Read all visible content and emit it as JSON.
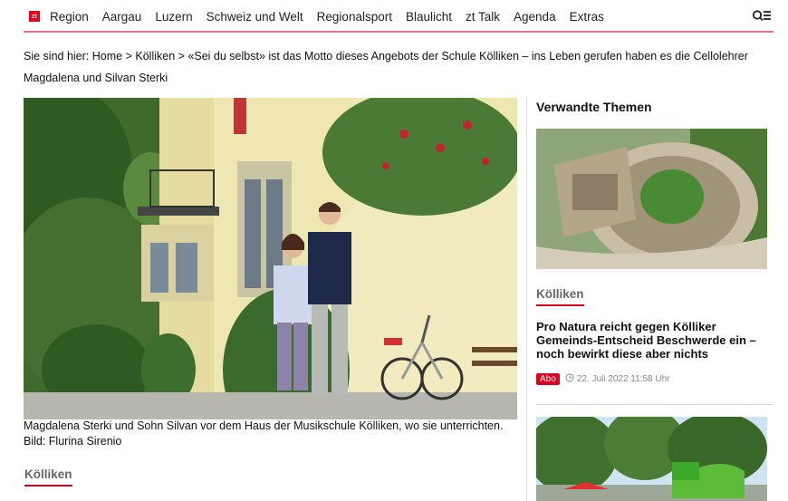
{
  "nav": {
    "logo": "zt",
    "items": [
      "Region",
      "Aargau",
      "Luzern",
      "Schweiz und Welt",
      "Regionalsport",
      "Blaulicht",
      "zt Talk",
      "Agenda",
      "Extras"
    ],
    "search_icon": "search-menu-icon"
  },
  "breadcrumb": {
    "prefix": "Sie sind hier:",
    "home": "Home",
    "section": "Kölliken",
    "current": "«Sei du selbst» ist das Motto dieses Angebots der Schule Kölliken – ins Leben gerufen haben es die Cellolehrer Magdalena und Silvan Sterki",
    "separator": ">"
  },
  "article": {
    "caption": "Magdalena Sterki und Sohn Silvan vor dem Haus der Musikschule Kölliken, wo sie unterrichten.",
    "credit": "Bild: Flurina Sirenio",
    "section_label": "Kölliken"
  },
  "sidebar": {
    "title": "Verwandte Themen",
    "teaser": {
      "section_label": "Kölliken",
      "headline": "Pro Natura reicht gegen Kölliker Gemeinds-Entscheid Beschwerde ein – noch bewirkt diese aber nichts",
      "badge": "Abo",
      "date": "22. Juli 2022 11:58 Uhr"
    }
  },
  "colors": {
    "accent": "#d9001f"
  }
}
